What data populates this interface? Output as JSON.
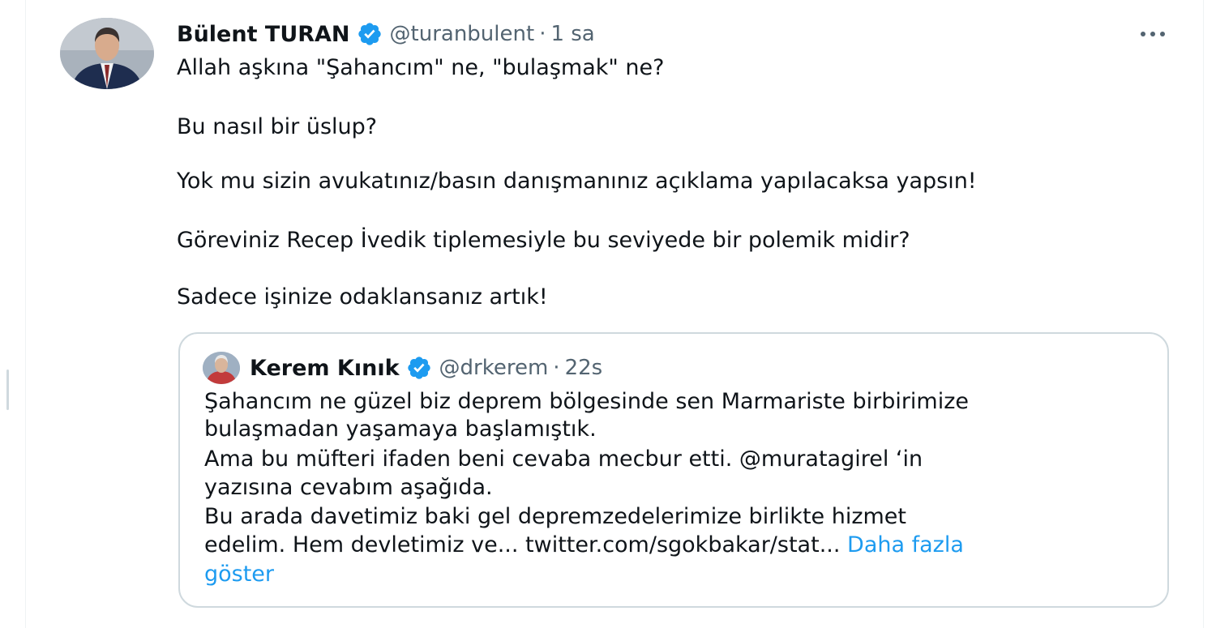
{
  "colors": {
    "accent": "#1d9bf0",
    "text": "#0f1419",
    "secondary_text": "#536471",
    "border": "#cfd9de"
  },
  "tweet": {
    "author": {
      "display_name": "Bülent TURAN",
      "handle": "@turanbulent",
      "verified_icon": "verified-badge-icon",
      "separator": "·",
      "time": "1 sa"
    },
    "more_icon": "more-options-icon",
    "text_lines": [
      "Allah aşkına \"Şahancım\" ne, \"bulaşmak\" ne?",
      "Bu nasıl bir üslup?",
      "Yok mu sizin avukatınız/basın danışmanınız açıklama yapılacaksa yapsın!",
      "Göreviniz Recep İvedik tiplemesiyle bu seviyede bir polemik midir?",
      "Sadece işinize odaklansanız artık!"
    ],
    "quoted_tweet": {
      "author": {
        "display_name": "Kerem Kınık",
        "handle": "@drkerem",
        "verified_icon": "verified-badge-icon",
        "separator": "·",
        "time": "22s"
      },
      "text_lines": [
        "Şahancım ne güzel biz deprem bölgesinde sen Marmariste birbirimize",
        "bulaşmadan yaşamaya başlamıştık.",
        "Ama bu müfteri ifaden beni cevaba mecbur etti. @muratagirel ‘in",
        "yazısına cevabım aşağıda.",
        "Bu arada davetimiz baki gel depremzedelerimize birlikte hizmet",
        "edelim. Hem devletimiz ve... twitter.com/sgokbakar/stat..."
      ],
      "show_more_part1": "Daha fazla",
      "show_more_part2": "göster"
    }
  }
}
